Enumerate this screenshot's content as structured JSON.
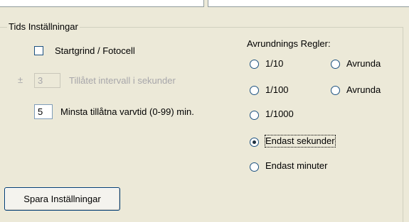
{
  "group": {
    "title": "Tids Inställningar"
  },
  "start_gate": {
    "label": "Startgrind / Fotocell",
    "checked": false
  },
  "interval": {
    "prefix": "±",
    "value": "3",
    "label": "Tillåtet intervall i sekunder",
    "enabled": false
  },
  "min_lap": {
    "value": "5",
    "label": "Minsta tillåtna varvtid (0-99) min."
  },
  "rounding": {
    "title": "Avrundnings Regler:",
    "options": [
      {
        "label": "1/10",
        "checked": false
      },
      {
        "label": "1/100",
        "checked": false
      },
      {
        "label": "1/1000",
        "checked": false
      },
      {
        "label": "Endast sekunder",
        "checked": true
      },
      {
        "label": "Endast minuter",
        "checked": false
      }
    ],
    "extra_options": [
      {
        "label": "Avrunda",
        "checked": false
      },
      {
        "label": "Avrunda",
        "checked": false
      }
    ]
  },
  "save_button": {
    "label": "Spara Inställningar"
  }
}
